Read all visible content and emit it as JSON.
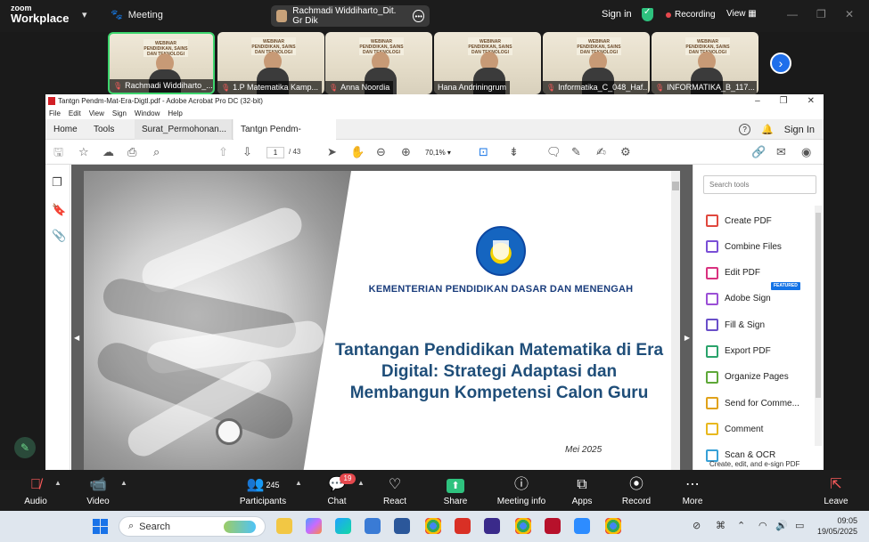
{
  "zoom": {
    "brand_line1": "zoom",
    "brand_line2": "Workplace",
    "meeting_label": "Meeting",
    "active_speaker": "Rachmadi Widdiharto_Dit. Gr Dik",
    "sign_in": "Sign in",
    "recording": "Recording",
    "view": "View",
    "participants": [
      {
        "name": "Rachmadi Widdiharto_...",
        "muted": true,
        "active": true
      },
      {
        "name": "1.P Matematika Kamp...",
        "muted": true,
        "active": false
      },
      {
        "name": "Anna Noordia",
        "muted": true,
        "active": false
      },
      {
        "name": "Hana Andriningrum",
        "muted": false,
        "active": false
      },
      {
        "name": "Informatika_C_048_Haf...",
        "muted": true,
        "active": false
      },
      {
        "name": "INFORMATIKA_B_117...",
        "muted": true,
        "active": false
      }
    ],
    "tile_banner": "WEBINAR PENDIDIKAN, SAINS DAN TEKNOLOGI",
    "controls": {
      "audio": "Audio",
      "video": "Video",
      "participants": "Participants",
      "participants_count": "245",
      "chat": "Chat",
      "chat_badge": "19",
      "react": "React",
      "share": "Share",
      "meeting_info": "Meeting info",
      "apps": "Apps",
      "record": "Record",
      "more": "More",
      "leave": "Leave"
    }
  },
  "acrobat": {
    "window_title": "Tantgn Pendm-Mat-Era-Digtl.pdf - Adobe Acrobat Pro DC (32-bit)",
    "menu": [
      "File",
      "Edit",
      "View",
      "Sign",
      "Window",
      "Help"
    ],
    "tabs": {
      "home": "Home",
      "tools": "Tools",
      "doc1": "Surat_Permohonan...",
      "doc2": "Tantgn Pendm-Mat..."
    },
    "sign_in": "Sign In",
    "page_current": "1",
    "page_total": "/ 43",
    "zoom_level": "70,1%",
    "search_tools_placeholder": "Search tools",
    "tools": [
      {
        "label": "Create PDF",
        "color": "#e0483e"
      },
      {
        "label": "Combine Files",
        "color": "#7a4fd6"
      },
      {
        "label": "Edit PDF",
        "color": "#d9317f"
      },
      {
        "label": "Adobe Sign",
        "color": "#9b4fd6"
      },
      {
        "label": "Fill & Sign",
        "color": "#6a4fc9"
      },
      {
        "label": "Export PDF",
        "color": "#2aa36b"
      },
      {
        "label": "Organize Pages",
        "color": "#5ea838"
      },
      {
        "label": "Send for Comme...",
        "color": "#e0a21a"
      },
      {
        "label": "Comment",
        "color": "#e8b81e"
      },
      {
        "label": "Scan & OCR",
        "color": "#37a0d6"
      }
    ],
    "featured_badge": "FEATURED",
    "panel_footer": "Create, edit, and e-sign PDF"
  },
  "slide": {
    "ministry": "KEMENTERIAN PENDIDIKAN DASAR DAN MENENGAH",
    "title_line1": "Tantangan Pendidikan Matematika di Era",
    "title_line2": "Digital: Strategi Adaptasi dan",
    "title_line3": "Membangun Kompetensi Calon Guru",
    "date": "Mei 2025"
  },
  "taskbar": {
    "search_placeholder": "Search",
    "time": "09:05",
    "date": "19/05/2025"
  },
  "colors": {
    "zoom_bg": "#1c1c1c",
    "share_green": "#2ec27e",
    "slide_title_blue": "#1f4e79",
    "active_tile_border": "#3dd56d"
  }
}
